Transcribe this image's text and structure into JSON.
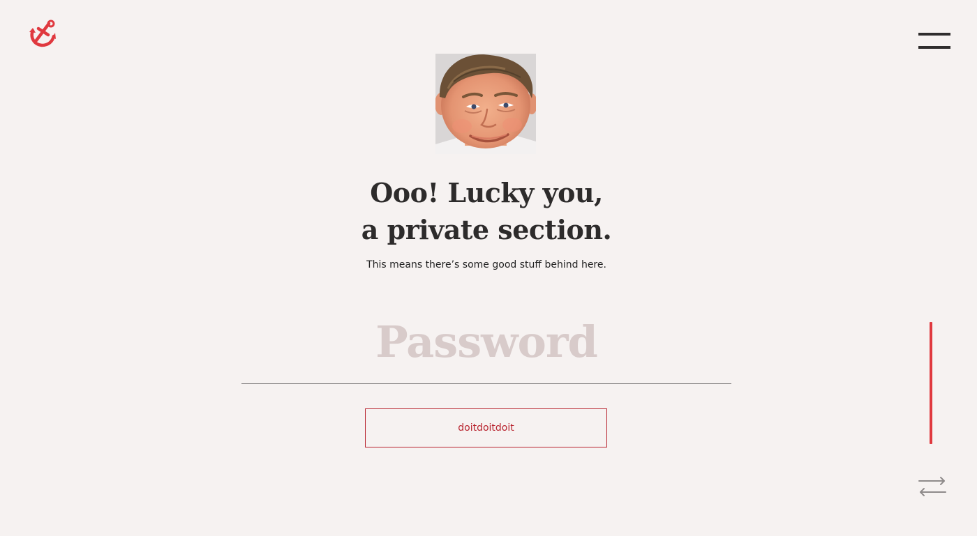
{
  "header": {
    "logo": {
      "icon": "anchor-icon",
      "color": "#e0393f"
    },
    "menu": {
      "icon": "hamburger-menu-icon"
    }
  },
  "main": {
    "avatar": {
      "icon": "smiling-man-avatar"
    },
    "heading_line1": "Ooo! Lucky you,",
    "heading_line2": "a private section.",
    "subtitle": "This means there’s some good stuff behind here.",
    "password": {
      "placeholder": "Password",
      "value": ""
    },
    "submit_label": "doitdoitdoit"
  },
  "sidebar": {
    "scroll_indicator_color": "#e0393f",
    "swap_icon": "swap-arrows-icon"
  },
  "colors": {
    "background": "#f6f2f1",
    "text": "#2d2b2b",
    "accent": "#b8232e",
    "placeholder": "#d8cbca"
  }
}
